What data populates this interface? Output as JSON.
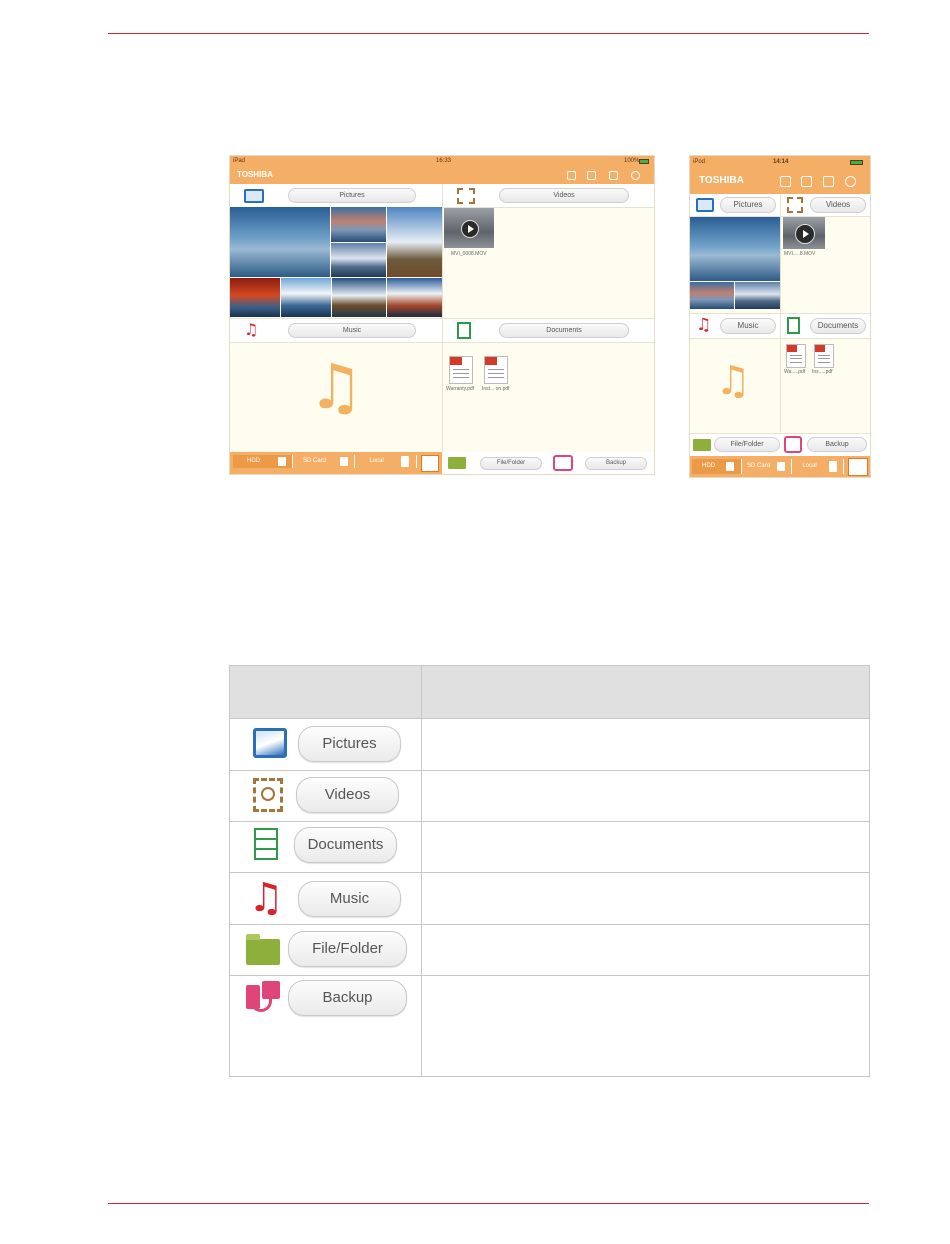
{
  "ipad": {
    "status_left": "iPad",
    "status_time": "16:33",
    "status_battery": "100%",
    "brand": "TOSHIBA",
    "sections": {
      "pictures": "Pictures",
      "videos": "Videos",
      "music": "Music",
      "documents": "Documents"
    },
    "video_caption": "MVI_0008.MOV",
    "doc_captions": [
      "Warranty.pdf",
      "Inst... on.pdf"
    ],
    "bottom": {
      "hdd": "HDD",
      "sd": "SD Card",
      "local": "Local"
    },
    "file_folder": "File/Folder",
    "backup": "Backup"
  },
  "ipod": {
    "status_left": "iPod",
    "status_time": "14:14",
    "brand": "TOSHIBA",
    "sections": {
      "pictures": "Pictures",
      "videos": "Videos",
      "music": "Music",
      "documents": "Documents"
    },
    "video_caption": "MVI.....8.MOV",
    "doc_captions": [
      "Wa.....pdf",
      "Ins.....pdf"
    ],
    "bottom": {
      "hdd": "HDD",
      "sd": "SD Card",
      "local": "Local"
    },
    "file_folder": "File/Folder",
    "backup": "Backup"
  },
  "table": {
    "header": [
      "",
      ""
    ],
    "rows": [
      {
        "icon": "pictures-icon",
        "label": "Pictures",
        "desc": ""
      },
      {
        "icon": "videos-icon",
        "label": "Videos",
        "desc": ""
      },
      {
        "icon": "documents-icon",
        "label": "Documents",
        "desc": ""
      },
      {
        "icon": "music-icon",
        "label": "Music",
        "desc": ""
      },
      {
        "icon": "file-folder-icon",
        "label": "File/Folder",
        "desc": ""
      },
      {
        "icon": "backup-icon",
        "label": "Backup",
        "desc": ""
      }
    ]
  },
  "colors": {
    "accent": "#f4ae66",
    "rule": "#c8283a",
    "pictures": "#2a6fb8",
    "videos": "#a9743a",
    "documents": "#2e9a4a",
    "music": "#d6232c",
    "folder": "#8db03a",
    "backup": "#e0457a"
  }
}
